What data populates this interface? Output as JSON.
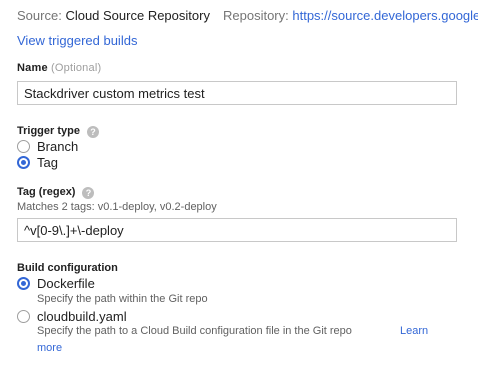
{
  "source": {
    "label": "Source:",
    "value": "Cloud Source Repository"
  },
  "repository": {
    "label": "Repository:",
    "url": "https://source.developers.google."
  },
  "view_builds_link": "View triggered builds",
  "name_field": {
    "label": "Name",
    "optional": "(Optional)",
    "value": "Stackdriver custom metrics test"
  },
  "trigger_type": {
    "label": "Trigger type",
    "options": [
      {
        "label": "Branch",
        "selected": false
      },
      {
        "label": "Tag",
        "selected": true
      }
    ]
  },
  "tag_field": {
    "label": "Tag (regex)",
    "matches": "Matches 2 tags: v0.1-deploy, v0.2-deploy",
    "value": "^v[0-9\\.]+\\-deploy"
  },
  "build_config": {
    "label": "Build configuration",
    "options": [
      {
        "label": "Dockerfile",
        "hint": "Specify the path within the Git repo",
        "selected": true
      },
      {
        "label": "cloudbuild.yaml",
        "hint": "Specify the path to a Cloud Build configuration file in the Git repo",
        "selected": false
      }
    ],
    "learn_more_1": "Learn",
    "learn_more_2": "more"
  },
  "help_icon_glyph": "?",
  "colors": {
    "accent": "#3367d6",
    "muted": "#757575"
  }
}
